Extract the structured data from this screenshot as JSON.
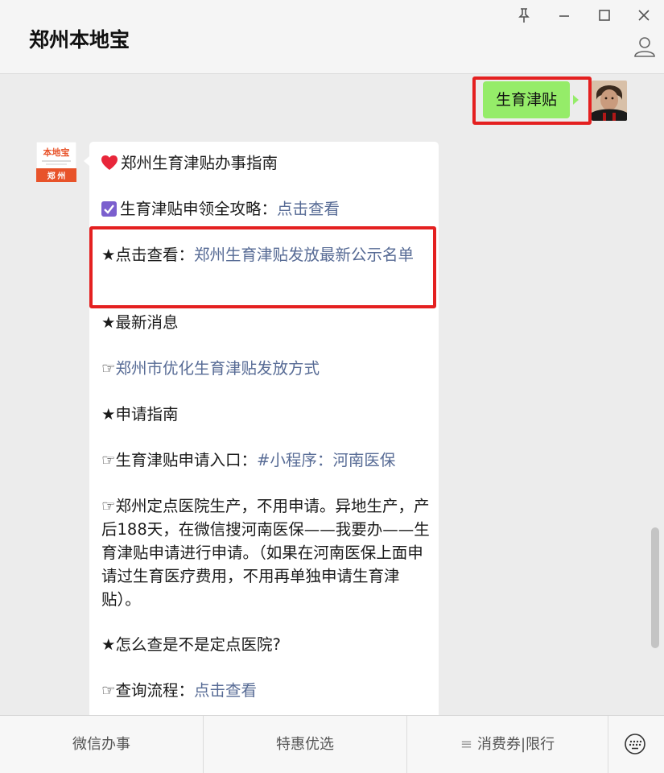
{
  "app": {
    "title": "郑州本地宝",
    "window_icons": [
      "pin-icon",
      "minimize-icon",
      "maximize-icon",
      "close-icon"
    ]
  },
  "sent_message": {
    "text": "生育津贴"
  },
  "bot_avatar": {
    "brand_top": "本地宝",
    "brand_bottom": "郑 州"
  },
  "message": {
    "line1": {
      "emoji": "heart-icon",
      "text": "郑州生育津贴办事指南"
    },
    "line2": {
      "emoji": "checkbox-icon",
      "prefix": "生育津贴申领全攻略：",
      "link": "点击查看"
    },
    "line3": {
      "prefix": "★点击查看：",
      "link": "郑州生育津贴发放最新公示名单"
    },
    "line4": {
      "text": "★最新消息"
    },
    "line5": {
      "prefix": "☞",
      "link": "郑州市优化生育津贴发放方式"
    },
    "line6": {
      "text": "★申请指南"
    },
    "line7": {
      "prefix": "☞生育津贴申请入口：",
      "link": "#小程序：河南医保"
    },
    "line8": {
      "text": "☞郑州定点医院生产，不用申请。异地生产，产后188天，在微信搜河南医保——我要办——生育津贴申请进行申请。（如果在河南医保上面申请过生育医疗费用，不用再单独申请生育津贴）。"
    },
    "line9": {
      "text": "★怎么查是不是定点医院?"
    },
    "line10": {
      "prefix": "☞查询流程：",
      "link": "点击查看"
    }
  },
  "menu": {
    "item1": "微信办事",
    "item2": "特惠优选",
    "item3_icon": "≡",
    "item3": "消费券|限行"
  },
  "colors": {
    "sent_bubble": "#95ec69",
    "link": "#576b95",
    "highlight": "#e42020",
    "brand_orange": "#e8532a"
  }
}
